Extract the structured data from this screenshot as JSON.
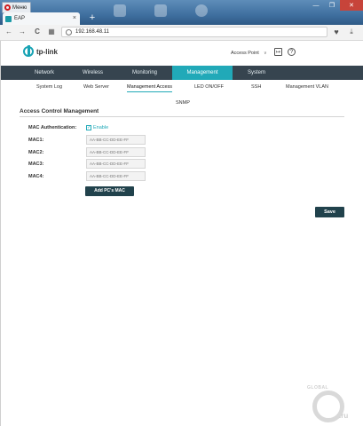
{
  "browser": {
    "menu_label": "Меню",
    "tab_title": "EAP",
    "url": "192.168.48.11",
    "new_tab_symbol": "+",
    "tab_close_symbol": "×",
    "back_symbol": "←",
    "forward_symbol": "→",
    "reload_symbol": "C",
    "grid_symbol": "▦",
    "window_controls": {
      "minimize": "—",
      "maximize": "❐",
      "close": "✕"
    }
  },
  "header": {
    "logo_text": "tp-link",
    "mode_label": "Access Point",
    "mode_arrow": "∨",
    "logout_icon_symbol": "↦",
    "help_icon_symbol": "?"
  },
  "main_nav": [
    "Network",
    "Wireless",
    "Monitoring",
    "Management",
    "System"
  ],
  "main_nav_active": "Management",
  "sub_nav": [
    "System Log",
    "Web Server",
    "Management Access",
    "LED ON/OFF",
    "SSH",
    "Management VLAN",
    "SNMP"
  ],
  "sub_nav_active": "Management Access",
  "section": {
    "title": "Access Control Management",
    "mac_auth_label": "MAC Authentication:",
    "enable_label": "Enable",
    "enable_checked": true,
    "check_mark": "✓",
    "mac_fields": [
      {
        "label": "MAC1:",
        "placeholder": "AA-BB-CC-DD-EE-FF"
      },
      {
        "label": "MAC2:",
        "placeholder": "AA-BB-CC-DD-EE-FF"
      },
      {
        "label": "MAC3:",
        "placeholder": "AA-BB-CC-DD-EE-FF"
      },
      {
        "label": "MAC4:",
        "placeholder": "AA-BB-CC-DD-EE-FF"
      }
    ],
    "add_button": "Add PC's MAC Address",
    "save_button": "Save"
  },
  "watermark": {
    "text": "GLOBAL",
    "suffix": ".ru"
  },
  "colors": {
    "accent": "#21a9b8",
    "nav_bg": "#36444f",
    "button_bg": "#21424c"
  }
}
